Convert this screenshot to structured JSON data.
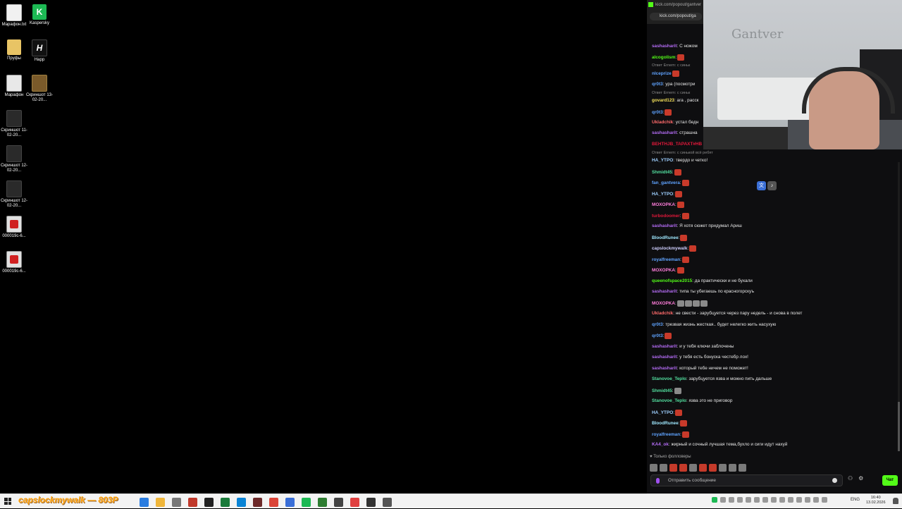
{
  "desktop": {
    "icons": [
      {
        "label": "Марафон.txt",
        "icon": "text-file-icon"
      },
      {
        "label": "Kaspersky",
        "icon": "kaspersky-icon"
      },
      {
        "label": "Пруфы",
        "icon": "folder-icon"
      },
      {
        "label": "Нарр",
        "icon": "h-app-icon"
      },
      {
        "label": "Марафон",
        "icon": "archive-icon"
      },
      {
        "label": "Скриншот 13-02-20...",
        "icon": "screenshot-icon"
      },
      {
        "label": "Скриншот 11-02-20...",
        "icon": "screenshot-icon"
      },
      {
        "label": "Скриншот 12-02-20...",
        "icon": "screenshot-icon"
      },
      {
        "label": "Скриншот 12-02-20...",
        "icon": "screenshot-icon"
      },
      {
        "label": "000019c-6...",
        "icon": "image-file-icon"
      },
      {
        "label": "000019c-6...",
        "icon": "image-file-icon"
      }
    ]
  },
  "popup": {
    "title": "kick.com/popout/gantver",
    "url": "kick.com/popout/ga"
  },
  "webcam": {
    "wall_text": "Gantver"
  },
  "chat": {
    "reply_prefix": "Ответ Ernem: с синьк",
    "reply_prefix_2": "Ответ Ernem: с синьк",
    "reply_prefix_3": "Ответ Ernem: с синькой всё ребят",
    "messages": [
      {
        "user": "sashasharit",
        "text": ": С ножом",
        "color": "#b46cf5"
      },
      {
        "user": "alcogolism",
        "text": ":",
        "color": "#53fc18"
      },
      {
        "user": "nlceprize",
        "text": "",
        "color": "#5fa3ff"
      },
      {
        "user": "qr0t3",
        "text": ": ура (посмотри",
        "color": "#5fa3ff"
      },
      {
        "user": "govard123",
        "text": ": ага , расск",
        "color": "#f3e05a"
      },
      {
        "user": "qr0t3",
        "text": ":",
        "color": "#5fa3ff"
      },
      {
        "user": "Ukladchik",
        "text": ": устал бедн",
        "color": "#ff6b6b"
      },
      {
        "user": "sashasharit",
        "text": ": страшна",
        "color": "#b46cf5"
      },
      {
        "user": "BEHTHJB_TAPAXT#HB",
        "text": "",
        "color": "#e2183a"
      },
      {
        "user": "HA_YTPO",
        "text": ": твердо и четко!",
        "color": "#9fd0ff"
      },
      {
        "user": "Shmidt45",
        "text": ":",
        "color": "#53e0a0"
      },
      {
        "user": "fan_gantvera",
        "text": ":",
        "color": "#5fa3ff"
      },
      {
        "user": "HA_YTPO",
        "text": ":",
        "color": "#9fd0ff"
      },
      {
        "user": "MOXOPKA",
        "text": ":",
        "color": "#ff7edb"
      },
      {
        "user": "turbodoomer",
        "text": ":",
        "color": "#e2183a"
      },
      {
        "user": "sashasharit",
        "text": ": Я хотя сюжет придумал Ариш",
        "color": "#b46cf5"
      },
      {
        "user": "BloodRunee",
        "text": ":",
        "color": "#9fe8ff"
      },
      {
        "user": "capslockmywalk",
        "text": ":",
        "color": "#cfcfff"
      },
      {
        "user": "royalfreeman",
        "text": ":",
        "color": "#5fa3ff"
      },
      {
        "user": "MOXOPKA",
        "text": ":",
        "color": "#ff7edb"
      },
      {
        "user": "queenofspace2015",
        "text": ": да практически и не бухали",
        "color": "#53fc18"
      },
      {
        "user": "sashasharit",
        "text": ": типа ты убегаешь по красногорскуъ",
        "color": "#b46cf5"
      },
      {
        "user": "MOXOPKA",
        "text": ":",
        "color": "#ff7edb"
      },
      {
        "user": "Ukladchik",
        "text": ": не свести - зарубцуется через пару недель - и снова в полет",
        "color": "#ff6b6b"
      },
      {
        "user": "qr0t3",
        "text": ": трезвая жизнь жесткая.. будет нелегко жить насухую",
        "color": "#5fa3ff"
      },
      {
        "user": "qr0t3",
        "text": ":",
        "color": "#5fa3ff"
      },
      {
        "user": "sashasharit",
        "text": ": и у тебя ключи заблочены",
        "color": "#b46cf5"
      },
      {
        "user": "sashasharit",
        "text": ": у тебя есть бонуска честебр лох!",
        "color": "#b46cf5"
      },
      {
        "user": "sashasharit",
        "text": ": который тебе ничем не поможет!",
        "color": "#b46cf5"
      },
      {
        "user": "Stanovoe_Teplo",
        "text": ": зарубцуется язва и можно пить дальше",
        "color": "#53e0a0"
      },
      {
        "user": "Shmidt45",
        "text": ":",
        "color": "#53e0a0"
      },
      {
        "user": "Stanovoe_Teplo",
        "text": ": язва это не приговор",
        "color": "#53e0a0"
      },
      {
        "user": "HA_YTPO",
        "text": ":",
        "color": "#9fd0ff"
      },
      {
        "user": "BloodRunee",
        "text": ":",
        "color": "#9fe8ff"
      },
      {
        "user": "royalfreeman",
        "text": ":",
        "color": "#5fa3ff"
      },
      {
        "user": "KA4_ok",
        "text": ": жирный и сочный лучшая тема,бухло и сиги идут нахуй",
        "color": "#b46cf5"
      }
    ],
    "followers_only": "Только фолловеры",
    "input_placeholder": "Отправить сообщение",
    "send_label": "Чат"
  },
  "taskbar": {
    "search_banner": "capslockmywalk — 803P",
    "lang": "ENG",
    "time": "16:40",
    "date": "13.02.2026"
  }
}
